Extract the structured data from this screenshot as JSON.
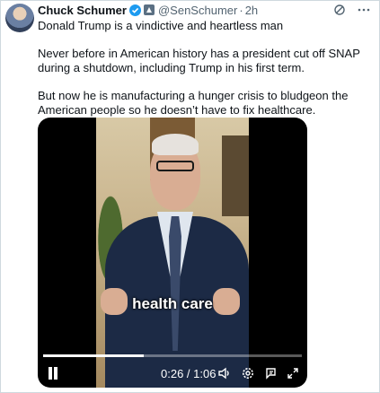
{
  "tweet": {
    "author_name": "Chuck Schumer",
    "handle": "@SenSchumer",
    "separator": "·",
    "time": "2h",
    "text_p1": "Donald Trump is a vindictive and heartless man",
    "text_p2": "Never before in American history has a president cut off SNAP during a shutdown, including Trump in his first term.",
    "text_p3": "But now he is manufacturing a hunger crisis to bludgeon the American people so he doesn’t have to fix healthcare."
  },
  "video": {
    "caption": "health care",
    "timecode": "0:26 / 1:06",
    "progress": 0.39
  },
  "icons": [
    "verified-badge-icon",
    "government-badge-icon",
    "grok-icon",
    "more-icon",
    "pause-icon",
    "volume-icon",
    "settings-icon",
    "captions-icon",
    "fullscreen-icon"
  ]
}
